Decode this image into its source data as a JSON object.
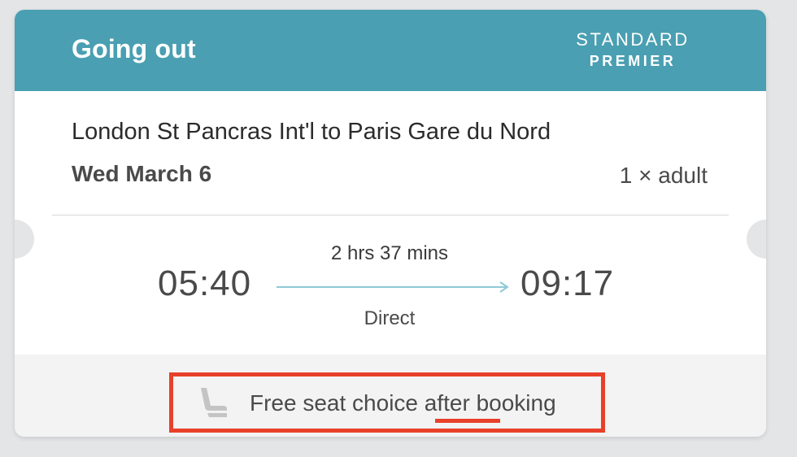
{
  "header": {
    "title": "Going out",
    "class_line1": "STANDARD",
    "class_line2": "PREMIER"
  },
  "journey": {
    "route": "London St Pancras Int'l to Paris Gare du Nord",
    "date": "Wed March 6",
    "passengers": "1 × adult",
    "depart_time": "05:40",
    "arrive_time": "09:17",
    "duration": "2 hrs 37 mins",
    "type": "Direct"
  },
  "footer": {
    "seat_text": "Free seat choice after booking",
    "seat_icon": "seat-icon"
  },
  "colors": {
    "header_bg": "#4a9fb2",
    "highlight": "#e8402a",
    "arrow": "#8fc9d6"
  }
}
